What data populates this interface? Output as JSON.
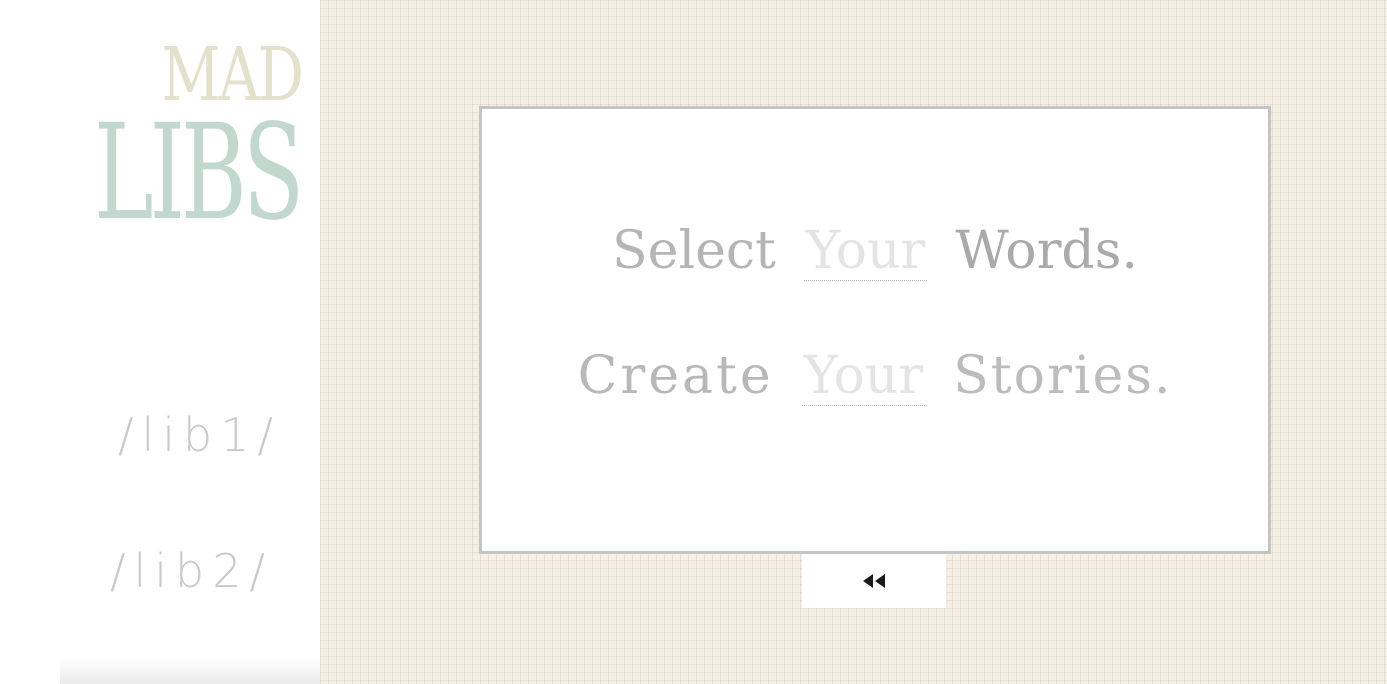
{
  "logo": {
    "top": "MAD",
    "bottom": "LIBS"
  },
  "nav": {
    "items": [
      {
        "label": "/lib1/"
      },
      {
        "label": "/lib2/"
      }
    ]
  },
  "card": {
    "line1": {
      "before": "Select",
      "blank": "Your",
      "after": "Words."
    },
    "line2": {
      "before": "Create",
      "blank": "Your",
      "after": "Stories."
    }
  },
  "controls": {
    "rewind_icon": "rewind-icon"
  },
  "colors": {
    "logo_mad": "#e3e0cc",
    "logo_libs": "#c2d8cf",
    "paper_bg": "#f5efe6",
    "card_border": "#c4c4c4",
    "text_gray": "#b3b3b3",
    "blank_text": "#e4e4e4",
    "icon": "#1a1a1a"
  }
}
